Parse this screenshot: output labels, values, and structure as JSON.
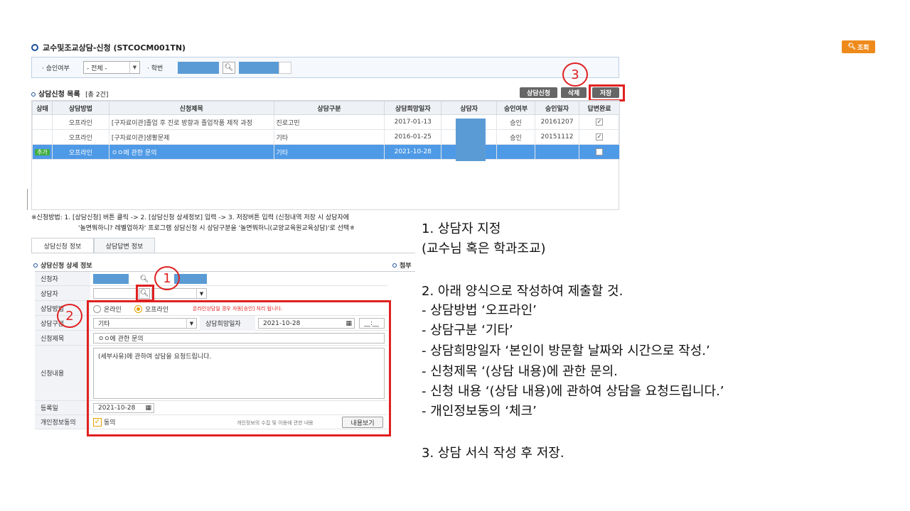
{
  "title": "교수및조교상담-신청 (STCOCM001TN)",
  "query_button": "조회",
  "search": {
    "approval_label": "· 승인여부",
    "approval_value": "- 전체 -",
    "student_id_label": "· 학번"
  },
  "list": {
    "title": "상담신청 목록",
    "count": "[총 2건]",
    "buttons": {
      "apply": "상담신청",
      "delete": "삭제",
      "save": "저장"
    },
    "columns": [
      "상태",
      "상담방법",
      "신청제목",
      "상담구분",
      "상담희망일자",
      "상담자",
      "승인여부",
      "승인일자",
      "답변완료"
    ],
    "rows": [
      {
        "status": "",
        "method": "오프라인",
        "title": "[구자료이관]졸업 후 진로 방향과 졸업작품 제작 과정",
        "category": "진로고민",
        "date": "2017-01-13",
        "approval": "승인",
        "approval_date": "20161207",
        "done": "✓"
      },
      {
        "status": "",
        "method": "오프라인",
        "title": "[구자료이관]생활문제",
        "category": "기타",
        "date": "2016-01-25",
        "approval": "승인",
        "approval_date": "20151112",
        "done": "✓"
      },
      {
        "status": "추가",
        "method": "오프라인",
        "title": "ㅇㅇ에 관한 문의",
        "category": "기타",
        "date": "2021-10-28",
        "approval": "",
        "approval_date": "",
        "done": ""
      }
    ]
  },
  "notes": {
    "line1": "※신청방법: 1. [상담신청] 버튼 클릭 -> 2. [상담신청 상세정보] 입력 -> 3. 저장버튼 입력 (신청내역 저장 시 상담자에",
    "line2": "'놀면뭐하니? 레벨업하자' 프로그램 상담신청 시 상담구분을 '놀면뭐하니(교양교육원교육상담)'로 선택ㅎ"
  },
  "tabs": [
    "상담신청 정보",
    "상담답변 정보"
  ],
  "detail": {
    "title": "상담신청 상세 정보",
    "side_title": "첨부",
    "labels": {
      "applicant": "신청자",
      "counselor": "상담자",
      "method": "상담방법",
      "category": "상담구분",
      "subject": "신청제목",
      "content": "신청내용",
      "reg_date": "등록일",
      "privacy": "개인정보동의"
    },
    "method_online": "온라인",
    "method_offline": "오프라인",
    "method_note": "온라인상담일 경우 자동[승인] 처리 됩니다.",
    "category_value": "기타",
    "hope_date_label": "상담희망일자",
    "hope_date_value": "2021-10-28",
    "hope_time_value": "__:__",
    "subject_value": "ㅇㅇ에 관한 문의",
    "content_value": "(세부사유)에 관하여 상담을 요청드립니다.",
    "reg_date_value": "2021-10-28",
    "privacy_check": "동의",
    "privacy_note": "개인정보의 수집 및 이용에 관한 내용",
    "privacy_button": "내용보기"
  },
  "markers": {
    "m1": "1",
    "m2": "2",
    "m3": "3"
  },
  "instructions": {
    "l1": "1.  상담자 지정",
    "l2": "(교수님 혹은 학과조교)",
    "l3": "2. 아래 양식으로 작성하여 제출할 것.",
    "l4": "- 상담방법 ‘오프라인’",
    "l5": "- 상담구분 ‘기타’",
    "l6": "-   상담희망일자 ‘본인이 방문할 날짜와 시간으로 작성.’",
    "l7": "- 신청제목 ‘(상담 내용)에 관한 문의.",
    "l8": "- 신청 내용 ‘(상담 내용)에 관하여 상담을 요청드립니다.’",
    "l9": "-   개인정보동의 ‘체크’",
    "l10": "3. 상담 서식 작성 후 저장."
  },
  "colors": {
    "accent": "#e02020",
    "selected_row": "#4f9ae6",
    "query": "#ee8a1b"
  }
}
